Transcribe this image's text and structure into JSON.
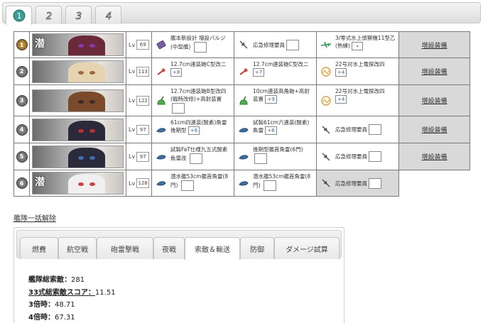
{
  "fleet_tabs": [
    {
      "label": "1",
      "active": true
    },
    {
      "label": "2",
      "active": false
    },
    {
      "label": "3",
      "active": false
    },
    {
      "label": "4",
      "active": false
    }
  ],
  "fleet": [
    {
      "pos": "1",
      "ship_kanji": "潜",
      "lv": "69",
      "eq": [
        {
          "name": "艦本新設計 増設バルジ(中型艦)",
          "mod": "",
          "icon": "bulge-icon"
        },
        {
          "name": "応急修理要員",
          "mod": "",
          "icon": "repair-crew-icon"
        },
        {
          "name": "3/零式水上偵察機11型乙(熟練)",
          "mod": "»",
          "icon": "seaplane-icon"
        }
      ],
      "extra": "増設装備"
    },
    {
      "pos": "2",
      "ship_kanji": "",
      "lv": "113",
      "eq": [
        {
          "name": "12.7cm連装砲C型改二",
          "mod": "+8",
          "icon": "small-gun-icon"
        },
        {
          "name": "12.7cm連装砲C型改二",
          "mod": "+7",
          "icon": "small-gun-icon"
        },
        {
          "name": "22号対水上電探改四",
          "mod": "+4",
          "icon": "radar-icon"
        }
      ],
      "extra": "増設装備"
    },
    {
      "pos": "3",
      "ship_kanji": "",
      "lv": "122",
      "eq": [
        {
          "name": "12.7cm連装砲B型改四(戦時改修)+高射装置",
          "mod": "",
          "icon": "aa-gun-icon"
        },
        {
          "name": "10cm連装高角砲+高射装置",
          "mod": "+9",
          "icon": "aa-gun-icon"
        },
        {
          "name": "22号対水上電探改四",
          "mod": "+4",
          "icon": "radar-icon"
        }
      ],
      "extra": "増設装備"
    },
    {
      "pos": "4",
      "ship_kanji": "",
      "lv": "97",
      "eq": [
        {
          "name": "61cm四連装(酸素)魚雷後期型",
          "mod": "+6",
          "icon": "torpedo-icon"
        },
        {
          "name": "試製61cm六連装(酸素)魚雷",
          "mod": "+6",
          "icon": "torpedo-icon"
        },
        {
          "name": "応急修理要員",
          "mod": "",
          "icon": "repair-crew-icon"
        }
      ],
      "extra": "増設装備"
    },
    {
      "pos": "5",
      "ship_kanji": "",
      "lv": "97",
      "eq": [
        {
          "name": "試製FaT仕様九五式酸素魚雷改",
          "mod": "",
          "icon": "torpedo-icon"
        },
        {
          "name": "後期型艦首魚雷(6門)",
          "mod": "",
          "icon": "torpedo-icon"
        },
        {
          "name": "応急修理要員",
          "mod": "",
          "icon": "repair-crew-icon"
        }
      ],
      "extra": "増設装備"
    },
    {
      "pos": "6",
      "ship_kanji": "潜",
      "lv": "128",
      "eq": [
        {
          "name": "潜水艦53cm艦首魚雷(8門)",
          "mod": "",
          "icon": "torpedo-icon"
        },
        {
          "name": "潜水艦53cm艦首魚雷(8門)",
          "mod": "",
          "icon": "torpedo-icon"
        },
        {
          "name": "応急修理要員",
          "mod": "",
          "icon": "repair-crew-icon"
        }
      ],
      "extra": ""
    }
  ],
  "release_all": "艦隊一括解除",
  "panel_tabs": [
    "燃費",
    "航空戦",
    "砲雷撃戦",
    "夜戦",
    "索敵＆輸送",
    "防御",
    "ダメージ試算"
  ],
  "panel_active": "索敵＆輸送",
  "stats": {
    "total_label": "艦隊総索敵：",
    "total_value": "281",
    "score33_label": "33式総索敵スコア：",
    "score33_value": "11.51",
    "x3_label": "3倍時：",
    "x3_value": "48.71",
    "x4_label": "4倍時：",
    "x4_value": "67.31"
  }
}
